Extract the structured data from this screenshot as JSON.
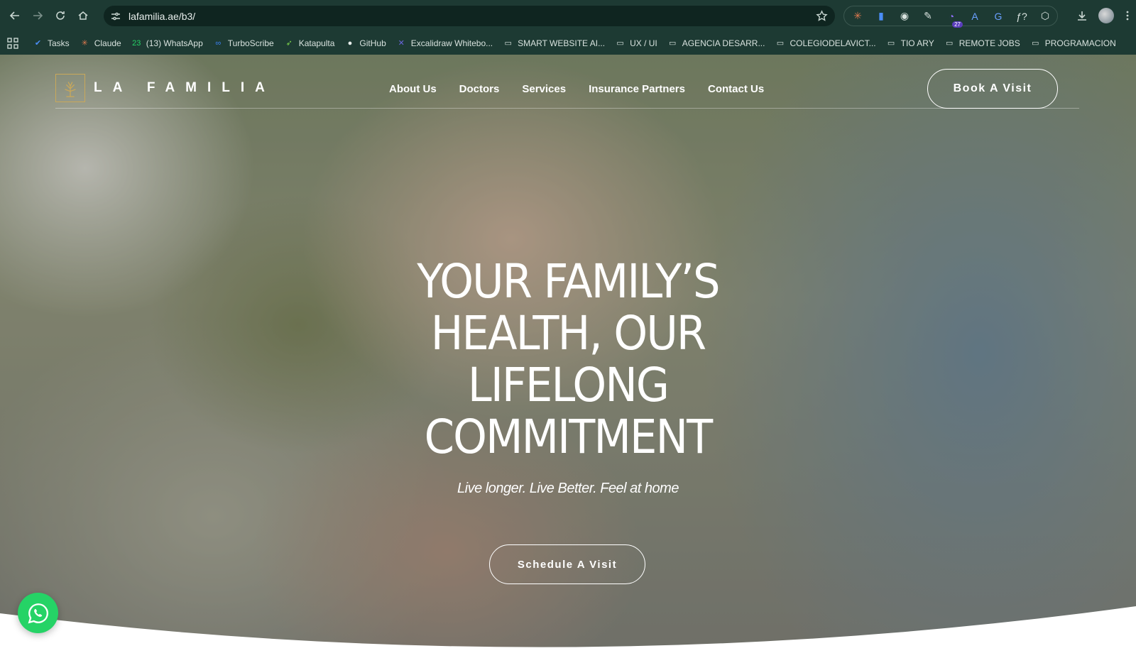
{
  "browser": {
    "url": "lafamilia.ae/b3/",
    "extensions": [
      {
        "icon": "claude-ext-icon",
        "glyph": "✳",
        "color": "#e07a4f"
      },
      {
        "icon": "docs-ext-icon",
        "glyph": "▮",
        "color": "#4a8df6"
      },
      {
        "icon": "camera-ext-icon",
        "glyph": "◉",
        "color": "#d8e2de"
      },
      {
        "icon": "picker-ext-icon",
        "glyph": "✎",
        "color": "#d8e2de"
      },
      {
        "icon": "grammar-ext-icon",
        "glyph": "◔",
        "color": "#8a6df0",
        "badge": "27"
      },
      {
        "icon": "font-ext-icon",
        "glyph": "A",
        "color": "#6aa0ff"
      },
      {
        "icon": "translate-ext-icon",
        "glyph": "G",
        "color": "#6aa0ff"
      },
      {
        "icon": "formula-ext-icon",
        "glyph": "ƒ?",
        "color": "#d8e2de"
      },
      {
        "icon": "puzzle-ext-icon",
        "glyph": "⬡",
        "color": "#d8e2de"
      }
    ],
    "bookmarks": [
      {
        "label": "Tasks",
        "icon": "tasks-icon",
        "glyph": "✔",
        "color": "#4a8df6"
      },
      {
        "label": "Claude",
        "icon": "claude-icon",
        "glyph": "✳",
        "color": "#e07a4f"
      },
      {
        "label": "(13) WhatsApp",
        "icon": "whatsapp-icon",
        "glyph": "23",
        "color": "#25d366"
      },
      {
        "label": "TurboScribe",
        "icon": "turboscribe-icon",
        "glyph": "∞",
        "color": "#3b82f6"
      },
      {
        "label": "Katapulta",
        "icon": "katapulta-icon",
        "glyph": "➶",
        "color": "#7bd34b"
      },
      {
        "label": "GitHub",
        "icon": "github-icon",
        "glyph": "●",
        "color": "#e8eeec"
      },
      {
        "label": "Excalidraw Whitebo...",
        "icon": "excalidraw-icon",
        "glyph": "✕",
        "color": "#6965db"
      },
      {
        "label": "SMART WEBSITE AI...",
        "icon": "folder-icon",
        "glyph": "▭",
        "color": "#d8e2de"
      },
      {
        "label": "UX / UI",
        "icon": "folder-icon",
        "glyph": "▭",
        "color": "#d8e2de"
      },
      {
        "label": "AGENCIA DESARR...",
        "icon": "folder-icon",
        "glyph": "▭",
        "color": "#d8e2de"
      },
      {
        "label": "COLEGIODELAVICT...",
        "icon": "folder-icon",
        "glyph": "▭",
        "color": "#d8e2de"
      },
      {
        "label": "TIO ARY",
        "icon": "folder-icon",
        "glyph": "▭",
        "color": "#d8e2de"
      },
      {
        "label": "REMOTE JOBS",
        "icon": "folder-icon",
        "glyph": "▭",
        "color": "#d8e2de"
      },
      {
        "label": "PROGRAMACION",
        "icon": "folder-icon",
        "glyph": "▭",
        "color": "#d8e2de"
      }
    ]
  },
  "site": {
    "logo_text": "LA FAMILIA",
    "nav": [
      "About Us",
      "Doctors",
      "Services",
      "Insurance Partners",
      "Contact Us"
    ],
    "book_button": "Book A Visit",
    "headline_lines": [
      "YOUR FAMILY’S",
      "HEALTH, OUR",
      "LIFELONG",
      "COMMITMENT"
    ],
    "tagline": "Live longer. Live Better. Feel at home",
    "schedule_button": "Schedule A Visit"
  }
}
